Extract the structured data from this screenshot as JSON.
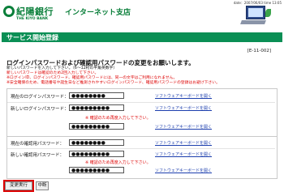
{
  "header": {
    "date": "date：2007/06/03 time 13:05",
    "bank_name": "紀陽銀行",
    "bank_name_en": "THE KIYO BANK",
    "branch": "インターネット支店"
  },
  "title_bar": {
    "title": "サービス開始登録"
  },
  "screen_code": "[E-11-002]",
  "content": {
    "heading": "ログインパスワードおよび確認用パスワードの変更をお願いします。",
    "notes": [
      "新しいパスワードを入力して下さい。（6～12桁の半角英数字）",
      "新しいパスワードは確認のため2回入力して下さい。",
      "※ログインID、ログインパスワード、確認用パスワードには、同一の文字はご利用になれません。",
      "※安全確保のため、電話番号や誕生日など推測されやすいログインパスワード、確認用パスワードの登録はお避け下さい。"
    ]
  },
  "login_form": {
    "current_label": "現在のログインパスワード：",
    "current_value": "●●●●●●●●",
    "new_label": "新しいログインパスワード：",
    "new_value": "●●●●●●●●●",
    "confirm_warning": "※ 確認のため再度入力して下さい。",
    "confirm_value": "●●●●●●●●●",
    "kb_link": "ソフトウェアキーボードを開く"
  },
  "confirm_form": {
    "current_label": "現在の確認用パスワード：",
    "current_value": "●●●●●●●●",
    "new_label": "新しい確認用パスワード：",
    "new_value": "●●●●●●●●●",
    "confirm_warning": "※ 確認のため再度入力して下さい。",
    "confirm_value": "●●●●●●●●●",
    "kb_link": "ソフトウェアキーボードを開く"
  },
  "buttons": {
    "execute": "変更実行",
    "cancel": "中断"
  },
  "colors": {
    "brand_green": "#0a7f3a",
    "title_bar": "#0a8f55",
    "warning": "#dd0000",
    "link": "#1d3fae"
  }
}
